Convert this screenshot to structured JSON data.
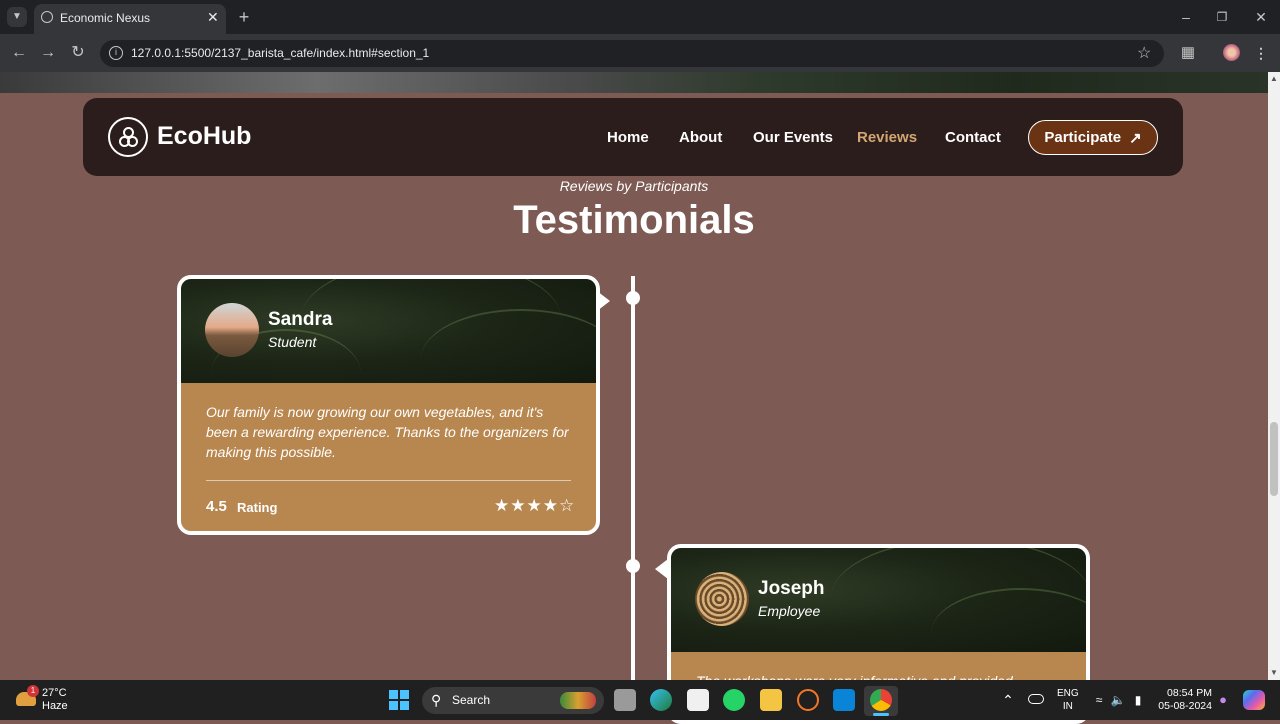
{
  "browser": {
    "tab_title": "Economic Nexus",
    "url": "127.0.0.1:5500/2137_barista_cafe/index.html#section_1"
  },
  "navbar": {
    "brand": "EcoHub",
    "links": [
      "Home",
      "About",
      "Our Events",
      "Reviews",
      "Contact"
    ],
    "active": "Reviews",
    "cta": "Participate",
    "active_color": "#d4a574"
  },
  "section": {
    "eyebrow": "Reviews by Participants",
    "title": "Testimonials"
  },
  "reviews": [
    {
      "name": "Sandra",
      "role": "Student",
      "text": "Our family is now growing our own vegetables, and it's been a rewarding experience. Thanks to the organizers for making this possible.",
      "rating": "4.5",
      "rating_label": "Rating",
      "stars_filled": 4,
      "stars_total": 5
    },
    {
      "name": "Joseph",
      "role": "Employee",
      "text": "The workshops were very informative and provided"
    }
  ],
  "taskbar": {
    "weather_temp": "27°C",
    "weather_desc": "Haze",
    "weather_badge": "1",
    "search": "Search",
    "lang1": "ENG",
    "lang2": "IN",
    "time": "08:54 PM",
    "date": "05-08-2024"
  }
}
